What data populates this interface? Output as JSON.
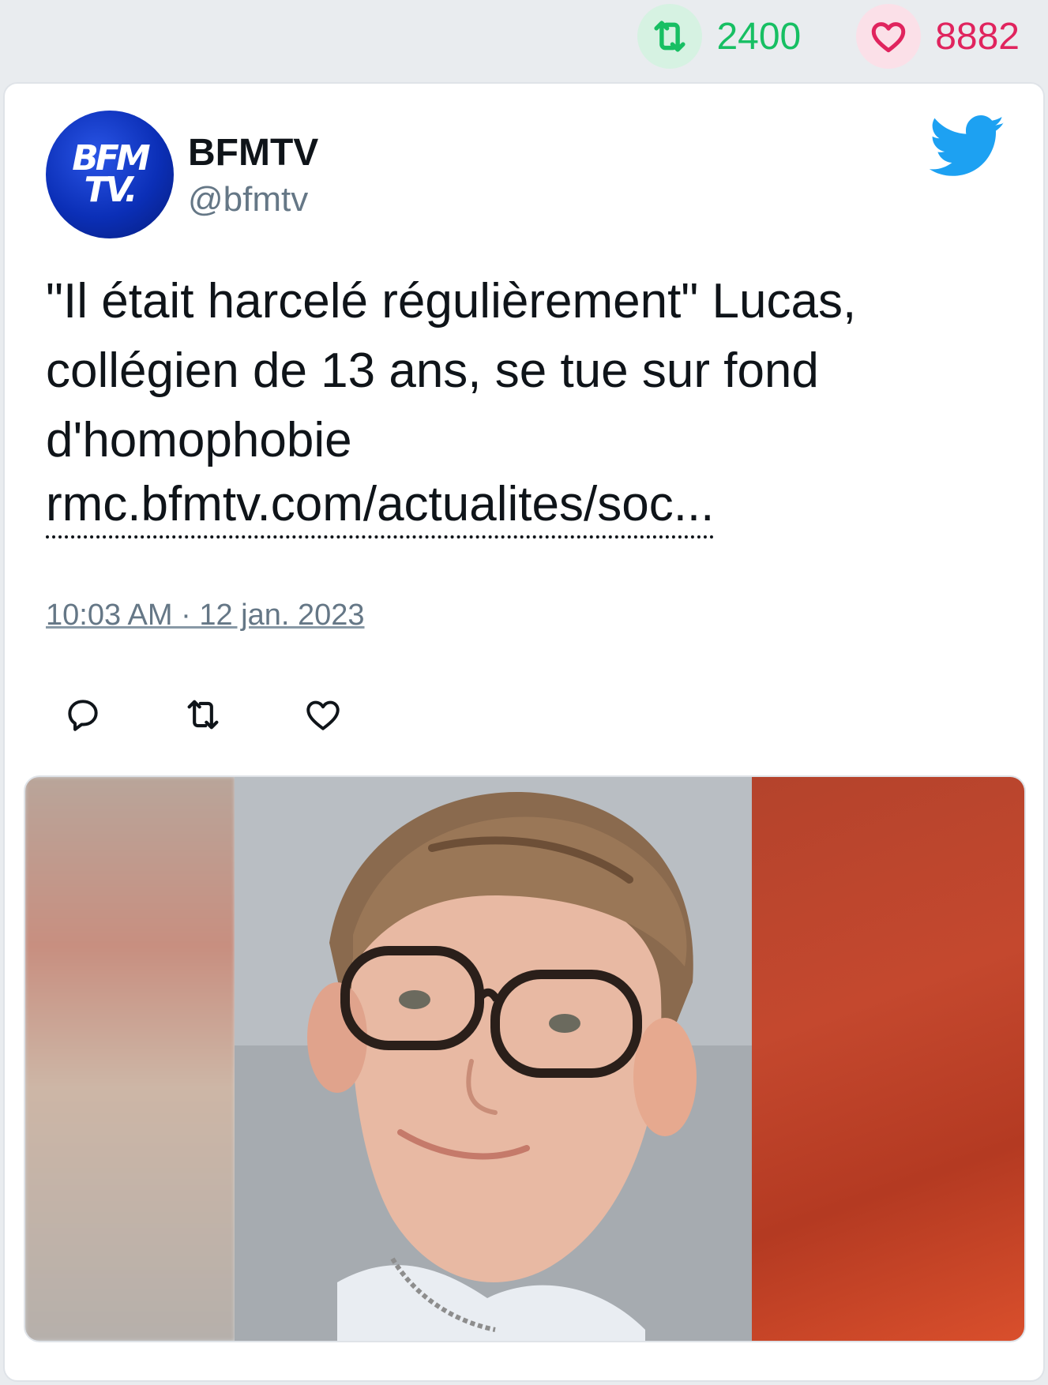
{
  "stats": {
    "retweets": "2400",
    "likes": "8882",
    "retweet_color": "#17bf63",
    "like_color": "#e0245e"
  },
  "tweet": {
    "author_name": "BFMTV",
    "author_handle": "@bfmtv",
    "avatar_text_line1": "BFM",
    "avatar_text_line2": "TV.",
    "text_lines": [
      "\"Il était harcelé régulièrement\" Lucas,",
      "collégien de 13 ans, se tue sur fond",
      "d'homophobie"
    ],
    "link": "rmc.bfmtv.com/actualites/soc...",
    "timestamp": "10:03 AM · 12 jan. 2023"
  },
  "icons": {
    "retweet_stat": "retweet-icon",
    "like_stat": "heart-icon",
    "logo": "twitter-bird-icon",
    "reply": "reply-icon",
    "retweet": "retweet-icon",
    "like": "heart-icon"
  },
  "colors": {
    "twitter_blue": "#1da1f2",
    "avatar_blue": "#0b2fb7",
    "muted_text": "#657786"
  }
}
